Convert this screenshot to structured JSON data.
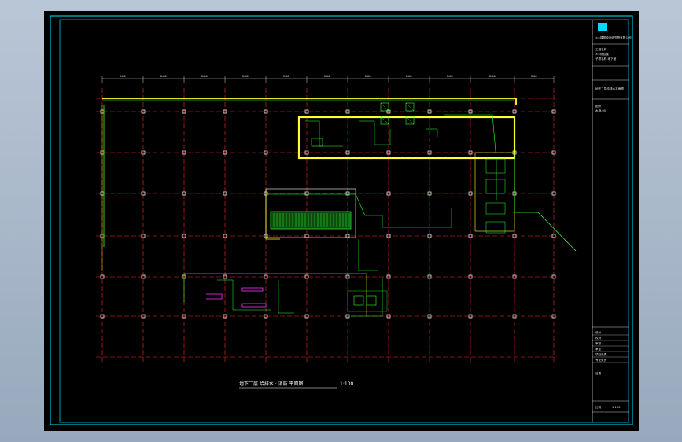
{
  "drawing": {
    "title": "地下二层 给排水 · 消防 平面图",
    "scale": "1:100",
    "dimensions": [
      "8400",
      "8400",
      "8400",
      "8400",
      "8400",
      "8400",
      "8400",
      "8400",
      "8400",
      "8400",
      "8400"
    ]
  },
  "title_block": {
    "logo_icon": "company-logo-icon",
    "company": "××建筑设计研究院有限公司",
    "project_lines": [
      "工程名称",
      "××综合楼",
      "子项名称 地下室"
    ],
    "drawing_name": "地下二层给排水平面图",
    "labels": [
      "设计",
      "校对",
      "审核",
      "审定",
      "项目负责",
      "专业负责"
    ],
    "stamp_cells": [
      "图号",
      "水施-05",
      "日期"
    ],
    "footer": [
      "比例",
      "1:100"
    ]
  },
  "colors": {
    "frame": "#00e5ff",
    "grid": "#ff2a2a",
    "pipe": "#33ff33",
    "wall": "#ffff33",
    "accent": "#ff33ff",
    "column": "#ffffff"
  }
}
